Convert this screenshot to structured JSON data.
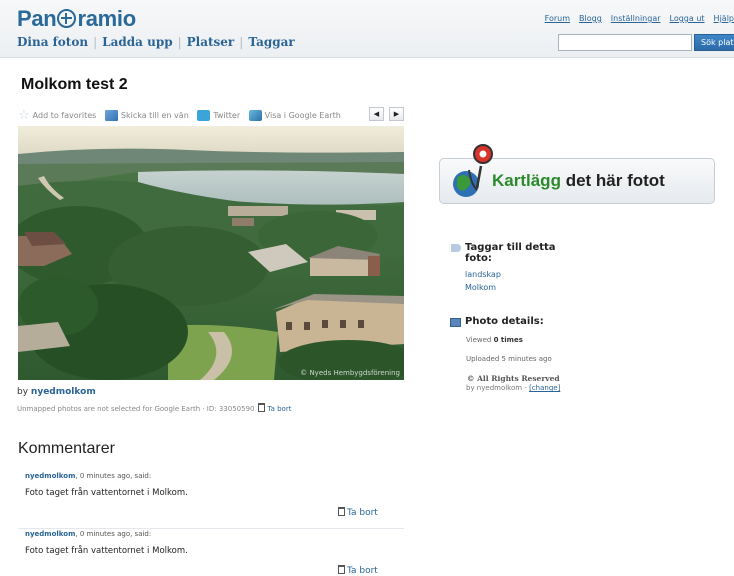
{
  "header": {
    "logo_part1": "Pan",
    "logo_part2": "ramio",
    "nav": [
      "Dina foton",
      "Ladda upp",
      "Platser",
      "Taggar"
    ],
    "top_links": [
      "Forum",
      "Blogg",
      "Inställningar",
      "Logga ut",
      "Hjälp"
    ],
    "search_value": "",
    "search_button": "Sök plats"
  },
  "photo": {
    "title": "Molkom test 2",
    "credit": "© Nyeds Hembygdsförening",
    "actions": {
      "favorites": "Add to favorites",
      "send": "Skicka till en vän",
      "twitter": "Twitter",
      "earth": "Visa i Google Earth"
    },
    "by_prefix": "by",
    "author": "nyedmolkom",
    "unmapped_note": "Unmapped photos are not selected for Google Earth · ID: 33050590",
    "delete_label": "Ta bort"
  },
  "comments": {
    "heading": "Kommentarer",
    "items": [
      {
        "author": "nyedmolkom",
        "meta": ", 0 minutes ago, said:",
        "text": "Foto taget från vattentornet i Molkom.",
        "delete": "Ta bort"
      },
      {
        "author": "nyedmolkom",
        "meta": ", 0 minutes ago, said:",
        "text": "Foto taget från vattentornet i Molkom.",
        "delete": "Ta bort"
      }
    ]
  },
  "sidebar": {
    "map_banner_highlight": "Kartlägg",
    "map_banner_rest": " det här fotot",
    "tags_heading_line1": "Taggar till detta",
    "tags_heading_line2": "foto:",
    "tags": [
      "landskap",
      "Molkom"
    ],
    "details_heading": "Photo details:",
    "viewed_prefix": "Viewed ",
    "viewed_count": "0 times",
    "uploaded": "Uploaded 5 minutes ago",
    "rights": "© All Rights Reserved",
    "rights_by": "by nyedmolkom - ",
    "change_link": "[change]"
  }
}
